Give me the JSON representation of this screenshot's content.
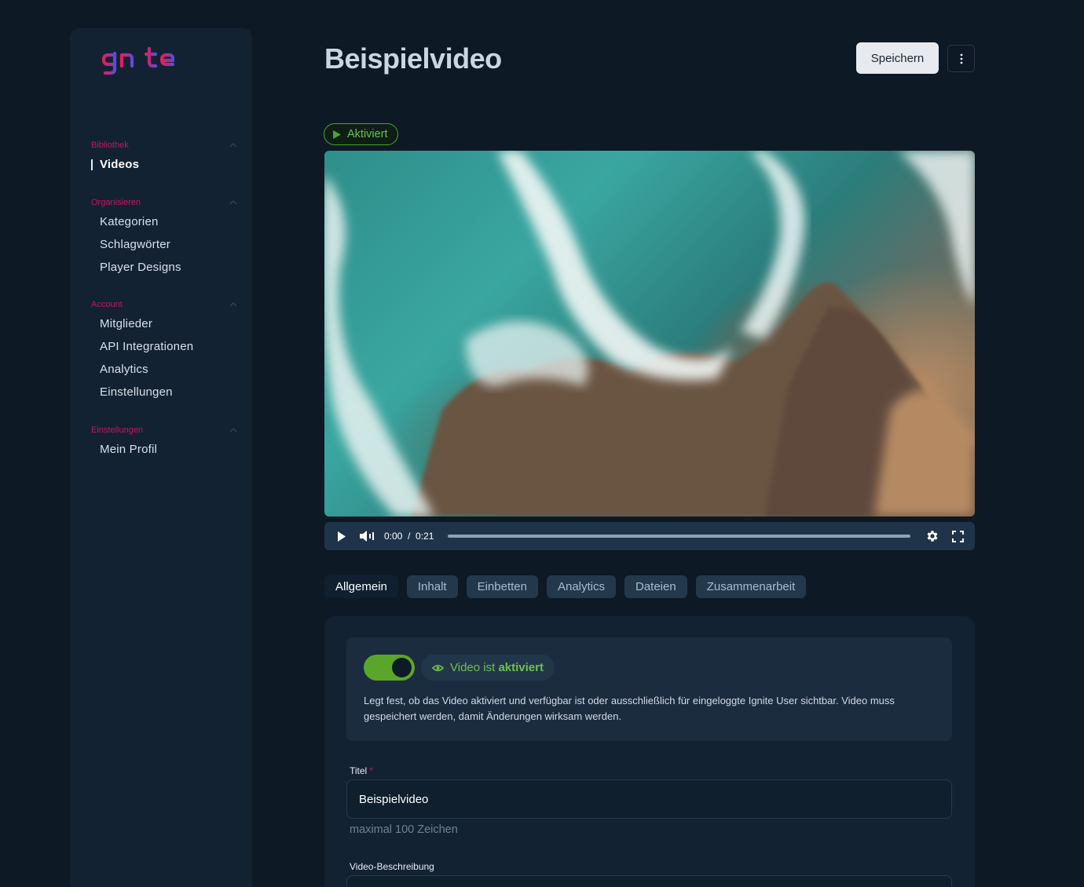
{
  "brand": {
    "logo_text": "Ignite",
    "colors": {
      "accent": "#c2185b",
      "success": "#6cc24a",
      "logo_start": "#e0205f",
      "logo_end": "#5b4bd6"
    }
  },
  "sidebar": {
    "sections": [
      {
        "title": "Bibliothek",
        "items": [
          {
            "label": "Videos",
            "active": true
          }
        ]
      },
      {
        "title": "Organisieren",
        "items": [
          {
            "label": "Kategorien"
          },
          {
            "label": "Schlagwörter"
          },
          {
            "label": "Player Designs"
          }
        ]
      },
      {
        "title": "Account",
        "items": [
          {
            "label": "Mitglieder"
          },
          {
            "label": "API Integrationen"
          },
          {
            "label": "Analytics"
          },
          {
            "label": "Einstellungen"
          }
        ]
      },
      {
        "title": "Einstellungen",
        "items": [
          {
            "label": "Mein Profil"
          }
        ]
      }
    ]
  },
  "header": {
    "title": "Beispielvideo",
    "save_label": "Speichern",
    "more_icon": "more-vertical-icon"
  },
  "status": {
    "label": "Aktiviert",
    "icon": "play-icon"
  },
  "player": {
    "current_time": "0:00",
    "separator": "/",
    "duration": "0:21",
    "progress": 0,
    "icons": [
      "play-icon",
      "volume-icon",
      "settings-icon",
      "fullscreen-icon"
    ]
  },
  "tabs": [
    {
      "label": "Allgemein",
      "active": true
    },
    {
      "label": "Inhalt"
    },
    {
      "label": "Einbetten"
    },
    {
      "label": "Analytics"
    },
    {
      "label": "Dateien"
    },
    {
      "label": "Zusammenarbeit"
    }
  ],
  "general": {
    "toggle_on": true,
    "state_prefix": "Video ist",
    "state_value": "aktiviert",
    "description": "Legt fest, ob das Video aktiviert und verfügbar ist oder ausschließlich für eingeloggte Ignite User sichtbar. Video muss gespeichert werden, damit Änderungen wirksam werden.",
    "title_label": "Titel",
    "required_marker": "*",
    "title_value": "Beispielvideo",
    "title_hint": "maximal 100 Zeichen",
    "description_label": "Video-Beschreibung"
  }
}
